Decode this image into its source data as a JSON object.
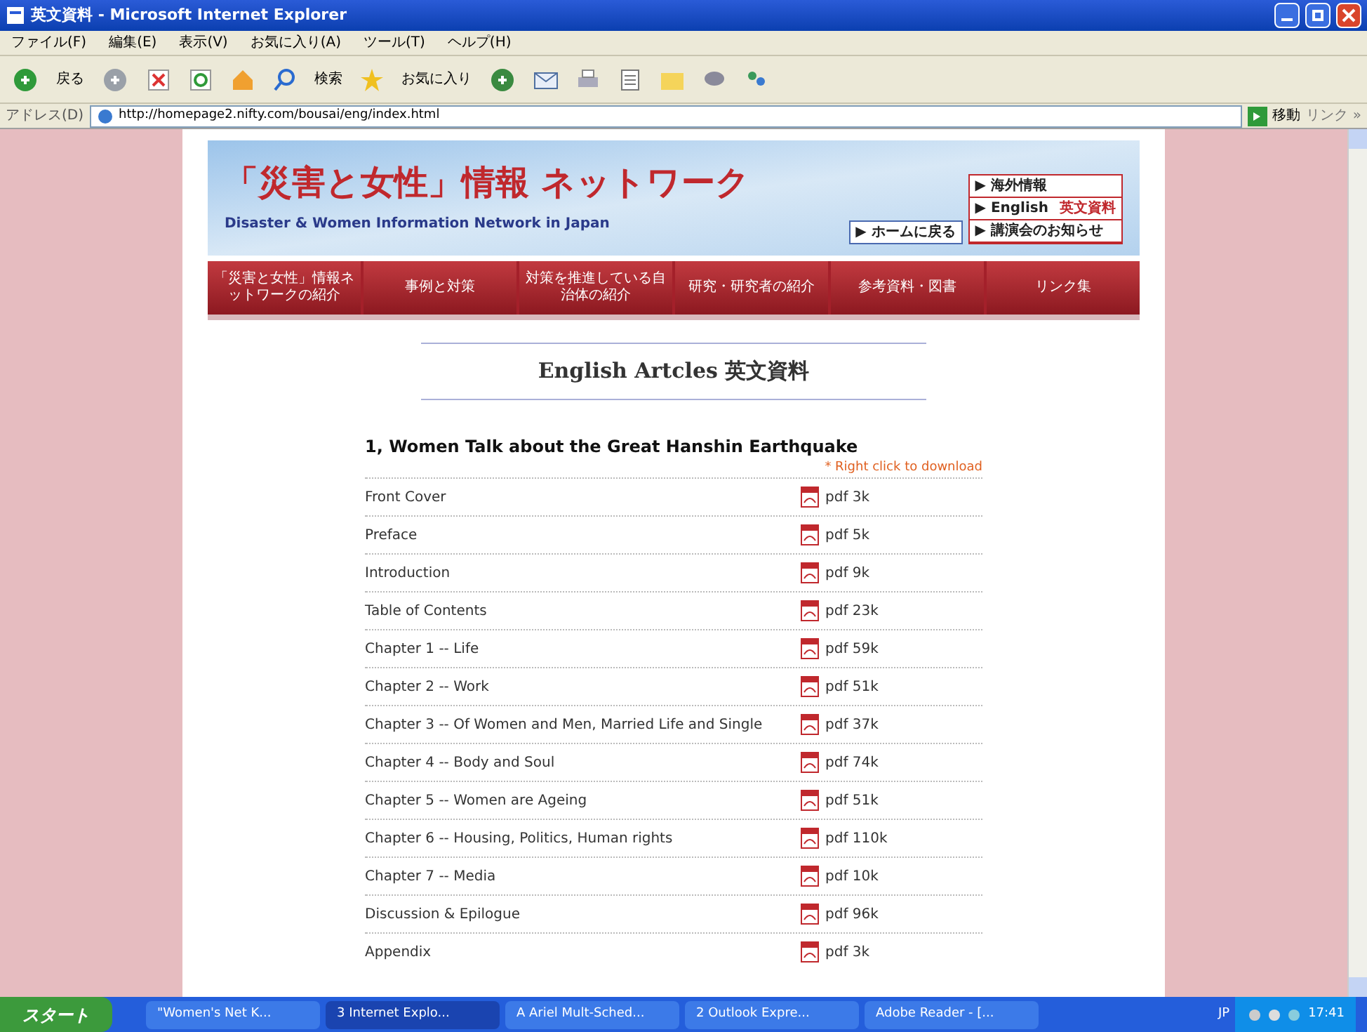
{
  "window": {
    "title": "英文資料 - Microsoft Internet Explorer"
  },
  "menu": [
    "ファイル(F)",
    "編集(E)",
    "表示(V)",
    "お気に入り(A)",
    "ツール(T)",
    "ヘルプ(H)"
  ],
  "toolbar": {
    "back": "戻る",
    "search": "検索",
    "favorites": "お気に入り"
  },
  "address": {
    "label": "アドレス(D)",
    "value": "http://homepage2.nifty.com/bousai/eng/index.html",
    "go": "移動",
    "links": "リンク »"
  },
  "banner": {
    "title": "「災害と女性」情報 ネットワーク",
    "subtitle": "Disaster & Women Information Network in Japan",
    "home": "▶ ホームに戻る",
    "side_links": [
      {
        "label": "▶ 海外情報"
      },
      {
        "label": "▶ English",
        "note": "英文資料"
      },
      {
        "label": "▶ 講演会のお知らせ"
      }
    ]
  },
  "nav": [
    "「災害と女性」情報ネットワークの紹介",
    "事例と対策",
    "対策を推進している自治体の紹介",
    "研究・研究者の紹介",
    "参考資料・図書",
    "リンク集"
  ],
  "heading": "English Artcles 英文資料",
  "section": {
    "title": "1, Women Talk about the Great Hanshin Earthquake",
    "hint": "* Right click to download",
    "rows": [
      {
        "name": "Front Cover",
        "file": "pdf 3k"
      },
      {
        "name": "Preface",
        "file": "pdf 5k"
      },
      {
        "name": "Introduction",
        "file": "pdf 9k"
      },
      {
        "name": "Table of Contents",
        "file": "pdf 23k"
      },
      {
        "name": "Chapter 1 -- Life",
        "file": "pdf 59k"
      },
      {
        "name": "Chapter 2 -- Work",
        "file": "pdf 51k"
      },
      {
        "name": "Chapter 3 -- Of Women and Men, Married Life and Single",
        "file": "pdf 37k"
      },
      {
        "name": "Chapter 4 -- Body and Soul",
        "file": "pdf 74k"
      },
      {
        "name": "Chapter 5 -- Women are Ageing",
        "file": "pdf 51k"
      },
      {
        "name": "Chapter 6 -- Housing, Politics, Human rights",
        "file": "pdf 110k"
      },
      {
        "name": "Chapter 7 -- Media",
        "file": "pdf 10k"
      },
      {
        "name": "Discussion & Epilogue",
        "file": "pdf 96k"
      },
      {
        "name": "Appendix",
        "file": "pdf 3k"
      }
    ]
  },
  "taskbar": {
    "start": "スタート",
    "items": [
      {
        "label": "\"Women's Net K...",
        "selected": false
      },
      {
        "label": "3 Internet Explo...",
        "selected": true
      },
      {
        "label": "A Ariel Mult-Sched...",
        "selected": false
      },
      {
        "label": "2 Outlook Expre...",
        "selected": false
      },
      {
        "label": "Adobe Reader - [...",
        "selected": false
      }
    ],
    "lang": "JP",
    "clock": "17:41"
  }
}
